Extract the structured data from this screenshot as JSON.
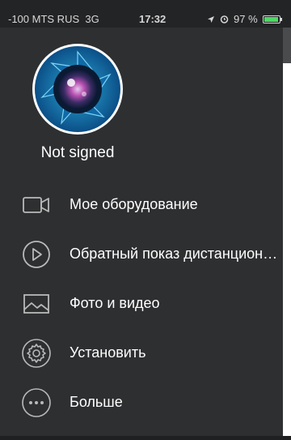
{
  "status_bar": {
    "carrier": "-100 MTS RUS",
    "network": "3G",
    "time": "17:32",
    "battery_percent": "97 %",
    "battery_level": 0.97
  },
  "profile": {
    "username": "Not signed",
    "avatar_icon": "camera-aperture-icon"
  },
  "menu": {
    "items": [
      {
        "label": "Мое оборудование",
        "icon": "video-camera-icon"
      },
      {
        "label": "Обратный показ дистанционного",
        "icon": "play-circle-icon"
      },
      {
        "label": "Фото и видео",
        "icon": "image-icon"
      },
      {
        "label": "Установить",
        "icon": "gear-icon"
      },
      {
        "label": "Больше",
        "icon": "more-icon"
      }
    ]
  },
  "colors": {
    "background": "#2e2f31",
    "text": "#ffffff",
    "icon_stroke": "#b9b9b9",
    "battery_fill": "#4cd964"
  }
}
